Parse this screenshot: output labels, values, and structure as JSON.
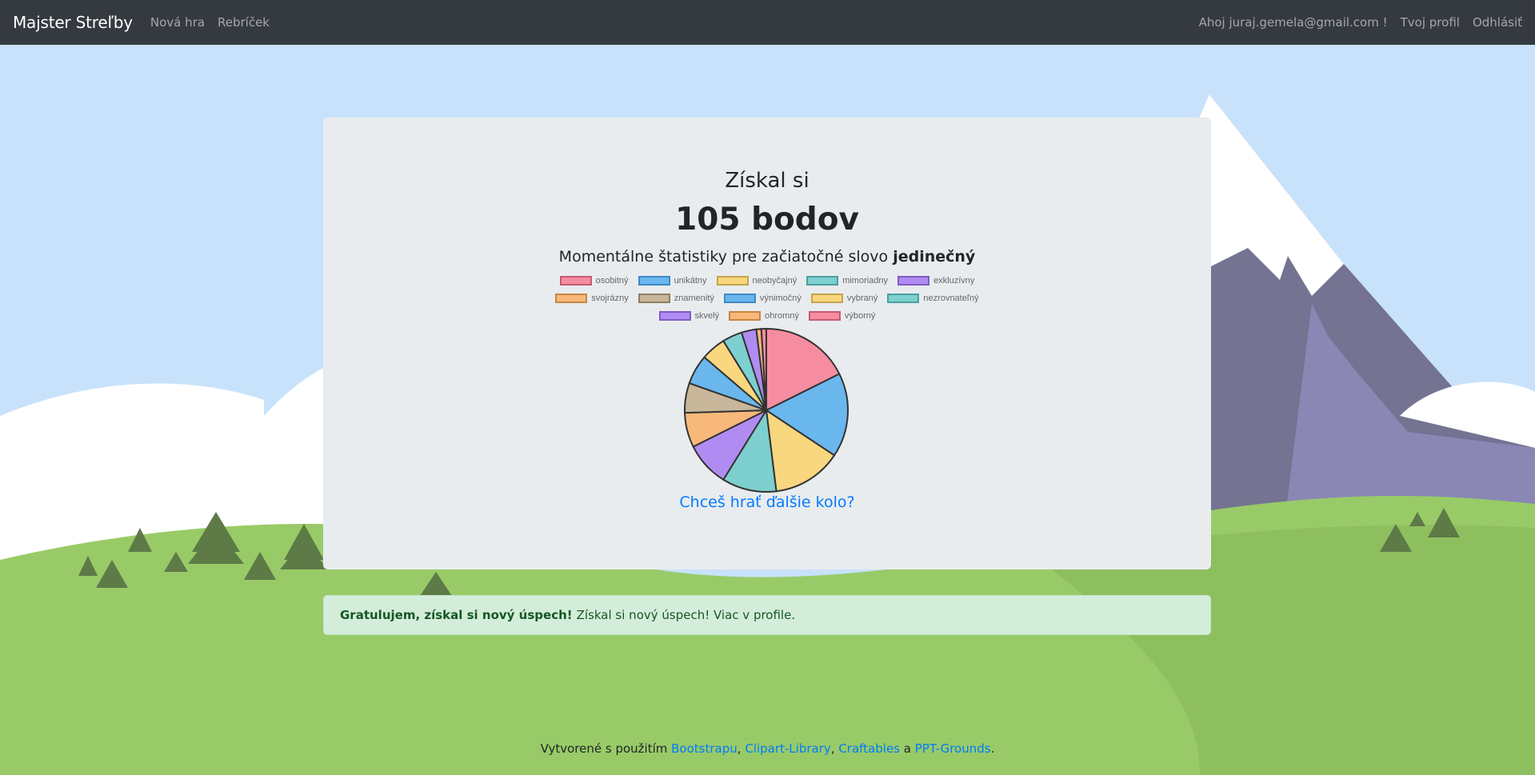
{
  "navbar": {
    "brand": "Majster Streľby",
    "links": [
      "Nová hra",
      "Rebríček"
    ],
    "greeting": "Ahoj juraj.gemela@gmail.com !",
    "profile": "Tvoj profil",
    "logout": "Odhlásiť"
  },
  "result": {
    "title": "Získal si",
    "score": "105 bodov",
    "stats_prefix": "Momentálne štatistiky pre začiatočné slovo",
    "word": "jedinečný",
    "play_again": "Chceš hrať ďalšie kolo?"
  },
  "chart_data": {
    "type": "pie",
    "labels": [
      "osobitný",
      "unikátny",
      "neobyčajný",
      "mimoriadny",
      "exkluzívny",
      "svojrázny",
      "znamenitý",
      "výnimočný",
      "vybraný",
      "nezrovnateľný",
      "skvelý",
      "ohromný",
      "výborný"
    ],
    "values": [
      18,
      17,
      14,
      11,
      9,
      7,
      6,
      6,
      5,
      4,
      3,
      1,
      1
    ],
    "colors": [
      "#f68ca0",
      "#6ab7ee",
      "#f9d77f",
      "#7ecfcf",
      "#b08cf2",
      "#f8b87a",
      "#c8b79a",
      "#6ab7ee",
      "#f9d77f",
      "#7ecfcf",
      "#b08cf2",
      "#f8b87a",
      "#f68ca0"
    ],
    "borders": [
      "#c65a72",
      "#3d88c8",
      "#c4a54a",
      "#4aa0a0",
      "#7f5cc4",
      "#c78640",
      "#8e7d60",
      "#3d88c8",
      "#c4a54a",
      "#4aa0a0",
      "#7f5cc4",
      "#c78640",
      "#c65a72"
    ],
    "legend_rows": [
      [
        0,
        1,
        2,
        3,
        4
      ],
      [
        5,
        6,
        7,
        8,
        9
      ],
      [
        10,
        11,
        12
      ]
    ]
  },
  "alert": {
    "strong": "Gratulujem, získal si nový úspech!",
    "text": "Získal si nový úspech! Viac v profile."
  },
  "footer": {
    "prefix": "Vytvorené s použitím",
    "links": [
      "Bootstrapu",
      "Clipart-Library",
      "Craftables",
      "PPT-Grounds"
    ],
    "sep1": ",",
    "sep2": ",",
    "and": "a",
    "end": "."
  }
}
